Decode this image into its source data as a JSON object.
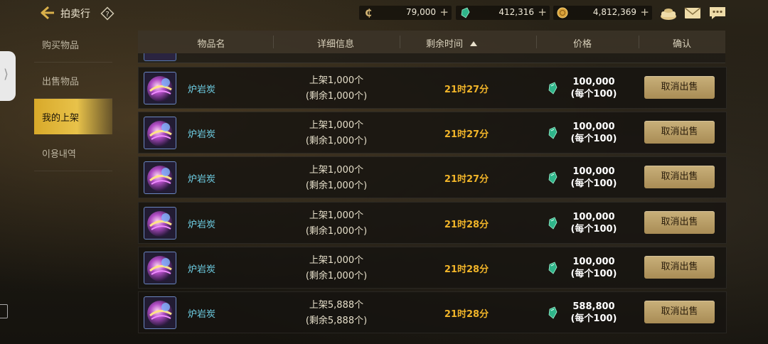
{
  "header": {
    "title": "拍卖行",
    "help_label": "?",
    "currencies": [
      {
        "icon": "coin-c-icon",
        "value": "79,000",
        "color": "#d4b574"
      },
      {
        "icon": "green-gem-icon",
        "value": "412,316",
        "color": "#2fb58a"
      },
      {
        "icon": "gold-coin-icon",
        "value": "4,812,369",
        "color": "#d9a23a"
      }
    ],
    "plus_label": "+"
  },
  "sidebar": {
    "handle_glyph": "⟩",
    "items": [
      {
        "label": "购买物品",
        "active": false
      },
      {
        "label": "出售物品",
        "active": false
      },
      {
        "label": "我的上架",
        "active": true
      },
      {
        "label": "이용내역",
        "active": false
      }
    ]
  },
  "table": {
    "columns": [
      "物品名",
      "详细信息",
      "剩余时间",
      "价格",
      "确认"
    ],
    "rows": [
      {
        "name": "炉岩炭",
        "listed": "上架1,000个",
        "remaining": "(剩余1,000个)",
        "time": "21时27分",
        "price": "100,000",
        "unit_price": "(每个100)",
        "action": "取消出售"
      },
      {
        "name": "炉岩炭",
        "listed": "上架1,000个",
        "remaining": "(剩余1,000个)",
        "time": "21时27分",
        "price": "100,000",
        "unit_price": "(每个100)",
        "action": "取消出售"
      },
      {
        "name": "炉岩炭",
        "listed": "上架1,000个",
        "remaining": "(剩余1,000个)",
        "time": "21时27分",
        "price": "100,000",
        "unit_price": "(每个100)",
        "action": "取消出售"
      },
      {
        "name": "炉岩炭",
        "listed": "上架1,000个",
        "remaining": "(剩余1,000个)",
        "time": "21时28分",
        "price": "100,000",
        "unit_price": "(每个100)",
        "action": "取消出售"
      },
      {
        "name": "炉岩炭",
        "listed": "上架1,000个",
        "remaining": "(剩余1,000个)",
        "time": "21时28分",
        "price": "100,000",
        "unit_price": "(每个100)",
        "action": "取消出售"
      },
      {
        "name": "炉岩炭",
        "listed": "上架5,888个",
        "remaining": "(剩余5,888个)",
        "time": "21时28分",
        "price": "588,800",
        "unit_price": "(每个100)",
        "action": "取消出售"
      }
    ]
  },
  "colors": {
    "accent_gold": "#e8c24a",
    "time_text": "#f0b429",
    "item_name": "#6fd0e6"
  }
}
